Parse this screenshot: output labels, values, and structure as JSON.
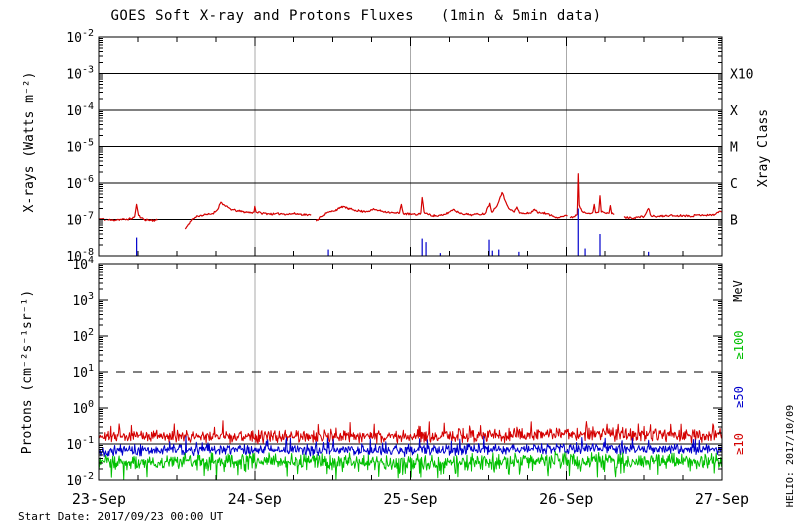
{
  "header": {
    "title": "GOES Soft X-ray and Protons Fluxes   (1min & 5min data)"
  },
  "footer": {
    "start_date": "Start Date: 2017/09/23 00:00 UT"
  },
  "watermark": "HELIO: 2017/10/09",
  "colors": {
    "xray_long": "#d40000",
    "xray_short": "#0000cc",
    "p10": "#d40000",
    "p50": "#0000cc",
    "p100": "#00c000",
    "grid": "#aaaaaa",
    "frame": "#000000"
  },
  "chart_data": {
    "type": "line",
    "title": "GOES Soft X-ray and Protons Fluxes (1min & 5min data)",
    "x_axis": {
      "start_hours": 0,
      "end_hours": 96,
      "day_labels": [
        "23-Sep",
        "24-Sep",
        "25-Sep",
        "26-Sep",
        "27-Sep"
      ],
      "day_label_hours": [
        0,
        24,
        48,
        72,
        96
      ],
      "day_gridlines_hours": [
        24,
        48,
        72
      ],
      "minor_tick_hours": 6
    },
    "panels": [
      {
        "name": "xray",
        "ylabel": "X-rays (Watts m⁻²)",
        "log_range": [
          -8,
          -2
        ],
        "tick_exponents": [
          -2,
          -3,
          -4,
          -5,
          -6,
          -7,
          -8
        ],
        "decade_lines": [
          -3,
          -4,
          -5,
          -6,
          -7
        ],
        "dashed_lines": [],
        "right_axis_title": "Xray Class",
        "right_labels": [
          {
            "text": "X10",
            "log": -3
          },
          {
            "text": "X",
            "log": -4
          },
          {
            "text": "M",
            "log": -5
          },
          {
            "text": "C",
            "log": -6
          },
          {
            "text": "B",
            "log": -7
          }
        ],
        "series": [
          {
            "name": "xray-long-wavelength",
            "color_key": "xray_long",
            "kind": "segments",
            "noise_decades": 0.028,
            "seed": 11,
            "segments": [
              [
                [
                  0,
                  1.05e-07
                ],
                [
                  1,
                  1e-07
                ],
                [
                  2,
                  9.5e-08
                ],
                [
                  3,
                  1e-07
                ],
                [
                  4,
                  1e-07
                ],
                [
                  5,
                  1.05e-07
                ],
                [
                  5.5,
                  1.2e-07
                ],
                [
                  5.8,
                  2.6e-07
                ],
                [
                  6.1,
                  1.3e-07
                ],
                [
                  6.5,
                  1.1e-07
                ],
                [
                  7,
                  1e-07
                ],
                [
                  8,
                  9.5e-08
                ],
                [
                  9,
                  9.5e-08
                ]
              ],
              [
                [
                  13.3,
                  5.5e-08
                ],
                [
                  13.8,
                  7.5e-08
                ],
                [
                  14.5,
                  1.05e-07
                ],
                [
                  15.2,
                  1.25e-07
                ],
                [
                  16.5,
                  1.35e-07
                ],
                [
                  17.5,
                  1.45e-07
                ],
                [
                  18.2,
                  1.8e-07
                ],
                [
                  18.8,
                  3e-07
                ],
                [
                  19.5,
                  2.3e-07
                ],
                [
                  20.5,
                  1.85e-07
                ],
                [
                  21.5,
                  1.7e-07
                ],
                [
                  22.5,
                  1.6e-07
                ],
                [
                  23.5,
                  1.55e-07
                ],
                [
                  23.9,
                  1.6e-07
                ],
                [
                  24.0,
                  2.3e-07
                ],
                [
                  24.2,
                  1.6e-07
                ],
                [
                  25,
                  1.5e-07
                ],
                [
                  26,
                  1.45e-07
                ],
                [
                  27,
                  1.4e-07
                ],
                [
                  28,
                  1.45e-07
                ],
                [
                  29,
                  1.4e-07
                ],
                [
                  30,
                  1.45e-07
                ],
                [
                  31,
                  1.4e-07
                ],
                [
                  32,
                  1.35e-07
                ],
                [
                  32.7,
                  1.3e-07
                ]
              ],
              [
                [
                  33.5,
                  9e-08
                ],
                [
                  34.2,
                  1.2e-07
                ],
                [
                  35,
                  1.5e-07
                ],
                [
                  36,
                  1.7e-07
                ],
                [
                  37,
                  2e-07
                ],
                [
                  37.6,
                  2.3e-07
                ],
                [
                  38.3,
                  2e-07
                ],
                [
                  39.5,
                  1.8e-07
                ],
                [
                  40.7,
                  1.65e-07
                ],
                [
                  41.8,
                  1.75e-07
                ],
                [
                  42.4,
                  1.9e-07
                ],
                [
                  43.2,
                  1.75e-07
                ],
                [
                  44.5,
                  1.6e-07
                ],
                [
                  45.5,
                  1.5e-07
                ],
                [
                  46.3,
                  1.5e-07
                ],
                [
                  46.6,
                  2.6e-07
                ],
                [
                  46.9,
                  1.45e-07
                ],
                [
                  48,
                  1.4e-07
                ],
                [
                  49,
                  1.35e-07
                ],
                [
                  49.6,
                  1.5e-07
                ],
                [
                  49.8,
                  4e-07
                ],
                [
                  50.1,
                  1.6e-07
                ],
                [
                  50.8,
                  1.35e-07
                ],
                [
                  52,
                  1.25e-07
                ],
                [
                  53,
                  1.3e-07
                ],
                [
                  54,
                  1.6e-07
                ],
                [
                  54.6,
                  1.9e-07
                ],
                [
                  55.4,
                  1.55e-07
                ],
                [
                  56.5,
                  1.4e-07
                ],
                [
                  57.5,
                  1.35e-07
                ],
                [
                  58.5,
                  1.4e-07
                ],
                [
                  59.5,
                  1.45e-07
                ],
                [
                  60.2,
                  2.8e-07
                ],
                [
                  60.5,
                  1.6e-07
                ],
                [
                  61.2,
                  2.2e-07
                ],
                [
                  62.1,
                  5.5e-07
                ],
                [
                  62.7,
                  3e-07
                ],
                [
                  63.3,
                  1.9e-07
                ],
                [
                  64.0,
                  1.6e-07
                ],
                [
                  64.4,
                  2.2e-07
                ],
                [
                  64.8,
                  1.5e-07
                ],
                [
                  65.6,
                  1.45e-07
                ],
                [
                  66.4,
                  1.5e-07
                ],
                [
                  67.1,
                  1.9e-07
                ],
                [
                  67.7,
                  1.5e-07
                ],
                [
                  68.4,
                  1.55e-07
                ],
                [
                  68.9,
                  1.45e-07
                ],
                [
                  69.6,
                  1.3e-07
                ],
                [
                  70.5,
                  1.15e-07
                ],
                [
                  71.3,
                  1.2e-07
                ],
                [
                  72.0,
                  1.3e-07
                ],
                [
                  72.2,
                  1.25e-07
                ]
              ],
              [
                [
                  72.6,
                  1.1e-07
                ],
                [
                  73.2,
                  1.2e-07
                ],
                [
                  73.7,
                  1.4e-07
                ],
                [
                  73.85,
                  1.8e-06
                ],
                [
                  74.0,
                  2.5e-07
                ],
                [
                  74.4,
                  1.7e-07
                ],
                [
                  74.9,
                  1.55e-07
                ],
                [
                  75.5,
                  1.5e-07
                ],
                [
                  76.1,
                  1.6e-07
                ],
                [
                  76.3,
                  2.6e-07
                ],
                [
                  76.5,
                  1.55e-07
                ],
                [
                  77.0,
                  1.6e-07
                ],
                [
                  77.2,
                  4.5e-07
                ],
                [
                  77.4,
                  1.6e-07
                ],
                [
                  78.0,
                  1.5e-07
                ],
                [
                  78.6,
                  1.5e-07
                ],
                [
                  78.8,
                  2.4e-07
                ],
                [
                  79.0,
                  1.45e-07
                ],
                [
                  79.4,
                  1.4e-07
                ]
              ],
              [
                [
                  80.9,
                  1.15e-07
                ],
                [
                  82,
                  1.1e-07
                ],
                [
                  83,
                  1.15e-07
                ],
                [
                  84,
                  1.2e-07
                ],
                [
                  84.7,
                  2e-07
                ],
                [
                  85.1,
                  1.25e-07
                ],
                [
                  86,
                  1.2e-07
                ],
                [
                  87,
                  1.25e-07
                ],
                [
                  88,
                  1.3e-07
                ],
                [
                  89,
                  1.25e-07
                ],
                [
                  90,
                  1.3e-07
                ],
                [
                  91,
                  1.25e-07
                ],
                [
                  92,
                  1.3e-07
                ],
                [
                  93,
                  1.35e-07
                ],
                [
                  94,
                  1.3e-07
                ],
                [
                  95,
                  1.4e-07
                ],
                [
                  95.7,
                  1.7e-07
                ],
                [
                  96,
                  1.6e-07
                ]
              ]
            ]
          },
          {
            "name": "xray-short-wavelength",
            "color_key": "xray_short",
            "kind": "spikes",
            "baseline": 1e-08,
            "spikes": [
              [
                5.8,
                3.2e-08
              ],
              [
                35.3,
                1.5e-08
              ],
              [
                49.8,
                3e-08
              ],
              [
                50.4,
                2.4e-08
              ],
              [
                52.6,
                1.2e-08
              ],
              [
                60.1,
                2.8e-08
              ],
              [
                60.6,
                1.4e-08
              ],
              [
                61.6,
                1.5e-08
              ],
              [
                64.7,
                1.3e-08
              ],
              [
                73.85,
                2e-07
              ],
              [
                74.9,
                1.6e-08
              ],
              [
                77.2,
                4e-08
              ],
              [
                84.7,
                1.3e-08
              ]
            ]
          }
        ]
      },
      {
        "name": "protons",
        "ylabel": "Protons (cm⁻²s⁻¹sr⁻¹)",
        "log_range": [
          -2,
          4
        ],
        "tick_exponents": [
          4,
          3,
          2,
          1,
          0,
          -1,
          -2
        ],
        "decade_lines": [
          -1
        ],
        "dashed_lines": [
          1
        ],
        "right_axis_title": "MeV",
        "right_labels": [
          {
            "text": "≥100",
            "color_key": "p100"
          },
          {
            "text": "≥50",
            "color_key": "p50"
          },
          {
            "text": "≥10",
            "color_key": "p10"
          }
        ],
        "series": [
          {
            "name": "protons-ge-10MeV",
            "color_key": "p10",
            "kind": "noisy",
            "noise_decades": 0.13,
            "spike_dir": 1,
            "seed": 21,
            "keypoints_log10": [
              [
                0,
                -0.8
              ],
              [
                12,
                -0.78
              ],
              [
                24,
                -0.8
              ],
              [
                36,
                -0.79
              ],
              [
                48,
                -0.8
              ],
              [
                60,
                -0.78
              ],
              [
                66,
                -0.76
              ],
              [
                72,
                -0.72
              ],
              [
                78,
                -0.72
              ],
              [
                84,
                -0.75
              ],
              [
                90,
                -0.78
              ],
              [
                96,
                -0.78
              ]
            ]
          },
          {
            "name": "protons-ge-50MeV",
            "color_key": "p50",
            "kind": "noisy",
            "noise_decades": 0.11,
            "spike_dir": 1,
            "seed": 22,
            "keypoints_log10": [
              [
                0,
                -1.18
              ],
              [
                24,
                -1.17
              ],
              [
                48,
                -1.18
              ],
              [
                72,
                -1.12
              ],
              [
                96,
                -1.15
              ]
            ]
          },
          {
            "name": "protons-ge-100MeV",
            "color_key": "p100",
            "kind": "noisy",
            "noise_decades": 0.16,
            "spike_dir": -1,
            "seed": 23,
            "keypoints_log10": [
              [
                0,
                -1.5
              ],
              [
                24,
                -1.48
              ],
              [
                48,
                -1.5
              ],
              [
                72,
                -1.45
              ],
              [
                96,
                -1.48
              ]
            ]
          }
        ]
      }
    ]
  }
}
